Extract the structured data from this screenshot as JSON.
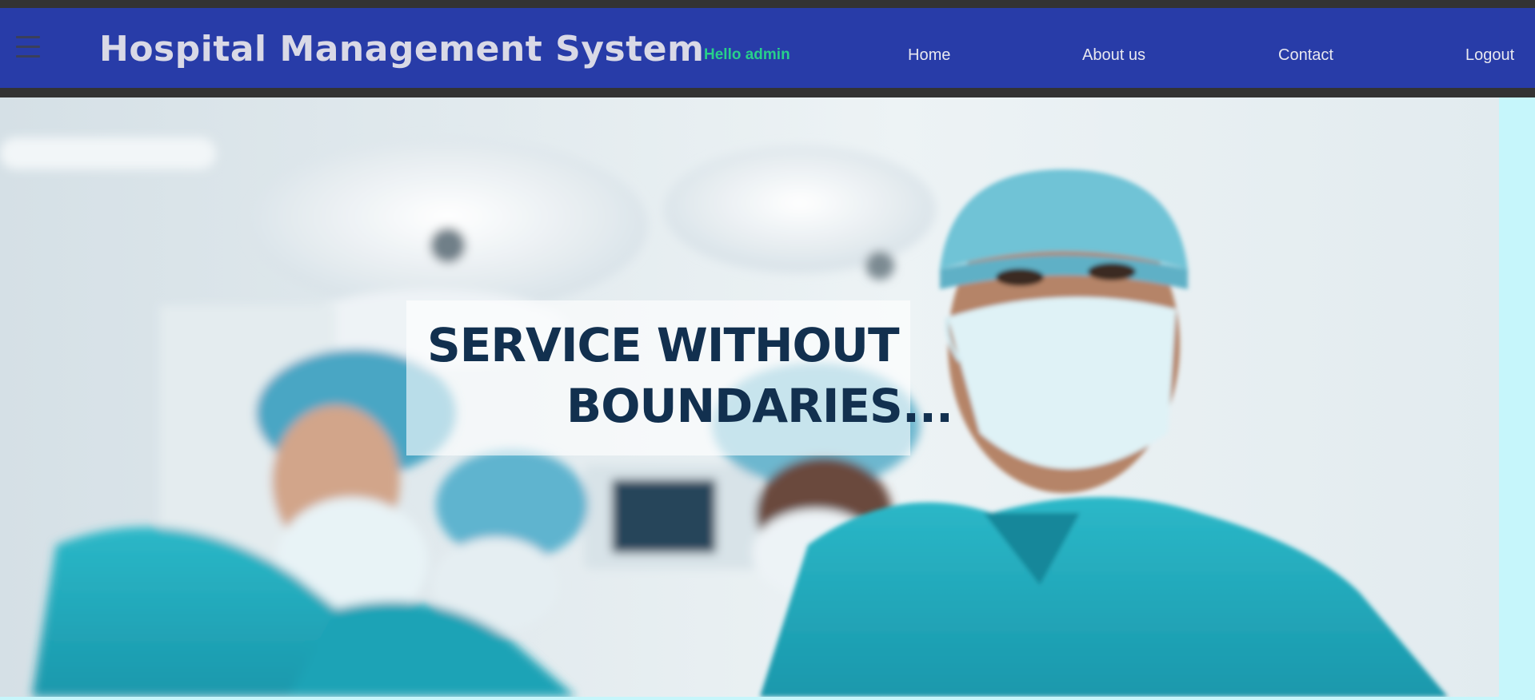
{
  "header": {
    "menu_icon": "hamburger-menu-icon",
    "brand_title": "Hospital Management System",
    "greeting": "Hello admin",
    "nav": {
      "home": "Home",
      "about": "About us",
      "contact": "Contact",
      "logout": "Logout"
    }
  },
  "hero": {
    "image": "surgeons-in-operating-room",
    "tagline_line1": "SERVICE WITHOUT",
    "tagline_line2": "BOUNDARIES..."
  },
  "colors": {
    "navbar": "#283ca8",
    "strip": "#333333",
    "greeting": "#27d08a",
    "page_bg": "#c6f6fb",
    "tagline": "#12304f"
  }
}
